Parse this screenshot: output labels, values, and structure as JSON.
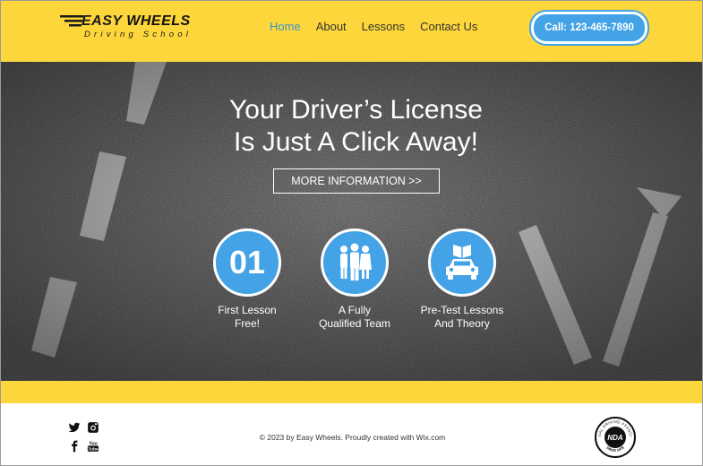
{
  "header": {
    "logo_title": "EASY",
    "logo_title_bold": "WHEELS",
    "logo_subtitle": "Driving School",
    "nav": [
      "Home",
      "About",
      "Lessons",
      "Contact Us"
    ],
    "call_button": "Call:  123-465-7890"
  },
  "hero": {
    "title_line1": "Your Driver’s License",
    "title_line2": "Is Just A Click Away!",
    "more_button": "MORE INFORMATION >>",
    "features": [
      {
        "number": "01",
        "label": "First Lesson\nFree!",
        "icon": "number-01"
      },
      {
        "label": "A Fully\nQualified Team",
        "icon": "team-icon"
      },
      {
        "label": "Pre-Test Lessons\nAnd Theory",
        "icon": "car-book-icon"
      }
    ]
  },
  "footer": {
    "copyright": "© 2023 by Easy Wheels. Proudly created with Wix.com",
    "social": [
      "twitter-icon",
      "instagram-icon",
      "facebook-icon",
      "youtube-icon"
    ],
    "badge_text": "NDA",
    "badge_top": "NATIONAL DRIVING ASSOCIATION",
    "badge_bottom": "SINCE 1978"
  },
  "colors": {
    "yellow": "#fcd63a",
    "blue": "#43a3e6",
    "nav_active": "#3a95c9"
  }
}
